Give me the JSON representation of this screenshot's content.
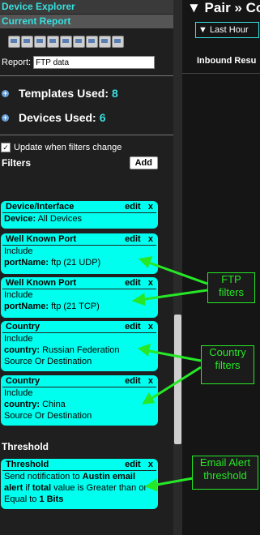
{
  "sidebar": {
    "device_explorer": "Device Explorer",
    "current_report": "Current Report",
    "report_label": "Report:",
    "report_value": "FTP data",
    "templates_label": "Templates Used:",
    "templates_count": "8",
    "devices_label": "Devices Used:",
    "devices_count": "6",
    "update_label": "Update when filters change",
    "filters_title": "Filters",
    "add_label": "Add",
    "edit_label": "edit",
    "close_label": "x",
    "threshold_title": "Threshold"
  },
  "filters": [
    {
      "title": "Device/Interface",
      "line1_label": "Device:",
      "line1_value": "All Devices"
    },
    {
      "title": "Well Known Port",
      "mode": "Include",
      "key": "portName:",
      "value": "ftp (21 UDP)"
    },
    {
      "title": "Well Known Port",
      "mode": "Include",
      "key": "portName:",
      "value": "ftp (21 TCP)"
    },
    {
      "title": "Country",
      "mode": "Include",
      "key": "country:",
      "value": "Russian Federation",
      "extra": "Source Or Destination"
    },
    {
      "title": "Country",
      "mode": "Include",
      "key": "country:",
      "value": "China",
      "extra": "Source Or Destination"
    }
  ],
  "threshold": {
    "title": "Threshold",
    "t1": "Send notification to",
    "b1": "Austin email alert",
    "t2": "if",
    "b2": "total",
    "t3": "value is Greater than or Equal to",
    "b3": "1 Bits"
  },
  "right": {
    "title": "▼ Pair » Co",
    "last_hour": "▼ Last Hour",
    "inbound": "Inbound Resu"
  },
  "callouts": {
    "ftp": "FTP filters",
    "country": "Country filters",
    "email": "Email Alert threshold"
  },
  "colors": {
    "accent": "#00ffee",
    "callout": "#26e826"
  }
}
